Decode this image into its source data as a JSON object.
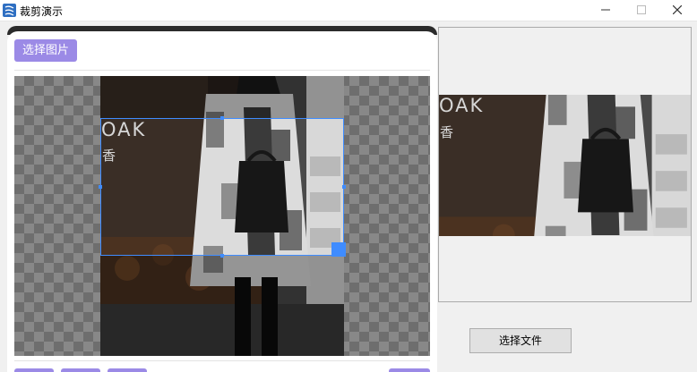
{
  "window": {
    "title": "裁剪演示",
    "icon": "scissors-app-icon"
  },
  "editor": {
    "select_image_label": "选择图片",
    "photo_text": {
      "brand": "OAK",
      "glyph": "香"
    }
  },
  "preview_panel": {
    "photo_text": {
      "brand": "OAK",
      "glyph": "香"
    }
  },
  "actions": {
    "select_file_label": "选择文件"
  },
  "colors": {
    "accent": "#9b8ae6",
    "crop": "#3f8cff"
  }
}
